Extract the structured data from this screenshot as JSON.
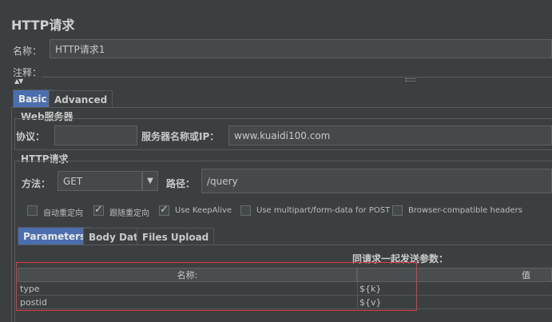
{
  "title": "HTTP请求",
  "name_label": "名称：",
  "name_value": "HTTP请求1",
  "comment_label": "注释：",
  "tabs_main": [
    {
      "label": "Basic",
      "active": true
    },
    {
      "label": "Advanced",
      "active": false
    }
  ],
  "web_server": {
    "section_title": "Web服务器",
    "protocol_label": "协议：",
    "protocol_value": "",
    "server_label": "服务器名称或IP：",
    "server_value": "www.kuaidi100.com"
  },
  "http_request": {
    "section_title": "HTTP请求",
    "method_label": "方法：",
    "method_value": "GET",
    "path_label": "路径：",
    "path_value": "/query"
  },
  "options": [
    {
      "label": "自动重定向",
      "checked": false
    },
    {
      "label": "跟随重定向",
      "checked": true
    },
    {
      "label": "Use KeepAlive",
      "checked": true
    },
    {
      "label": "Use multipart/form-data for POST",
      "checked": false
    },
    {
      "label": "Browser-compatible headers",
      "checked": false
    }
  ],
  "tabs_params": [
    {
      "label": "Parameters",
      "active": true
    },
    {
      "label": "Body Data",
      "active": false
    },
    {
      "label": "Files Upload",
      "active": false
    }
  ],
  "params": {
    "caption": "同请求一起发送参数：",
    "columns": [
      "名称:",
      "值"
    ],
    "rows": [
      {
        "name": "type",
        "value": "${k}"
      },
      {
        "name": "postid",
        "value": "${v}"
      }
    ]
  },
  "colors": {
    "background": "#3c3f41",
    "accent_tab": "#4b6eaf",
    "highlight_box": "#e0393e"
  }
}
